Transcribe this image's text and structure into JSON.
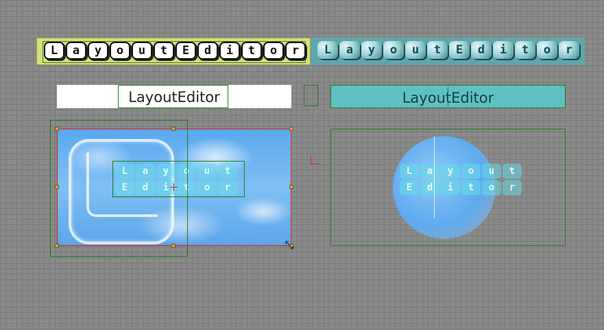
{
  "banners": {
    "left_letters": [
      "L",
      "a",
      "y",
      "o",
      "u",
      "t",
      "E",
      "d",
      "i",
      "t",
      "o",
      "r"
    ],
    "right_letters": [
      "L",
      "a",
      "y",
      "o",
      "u",
      "t",
      "E",
      "d",
      "i",
      "t",
      "o",
      "r"
    ]
  },
  "text_widgets": {
    "left_label": "LayoutEditor",
    "right_label": "LayoutEditor"
  },
  "overlay_glyphs": [
    "L",
    "a",
    "y",
    "o",
    "u",
    "t",
    "E",
    "d",
    "i",
    "t",
    "o",
    "r"
  ],
  "icons": {
    "resize": "resize-diagonal-icon",
    "crosshair": "crosshair-icon"
  },
  "colors": {
    "selection": "#1e7d1e",
    "active_selection": "#dd2222",
    "banner_left_bg": "#d6df7c",
    "banner_right_bg": "#5fa5ab",
    "text_right_bg": "#5fc0c3"
  }
}
